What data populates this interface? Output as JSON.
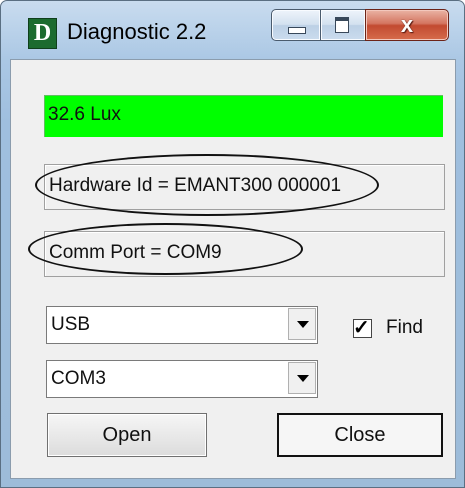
{
  "window": {
    "icon_letter": "D",
    "title": "Diagnostic 2.2",
    "close_glyph": "x"
  },
  "readings": {
    "lux": "32.6 Lux",
    "hardware_id": "Hardware Id = EMANT300 000001",
    "comm_port": "Comm Port = COM9"
  },
  "controls": {
    "interface_select": "USB",
    "port_select": "COM3",
    "find_label": "Find",
    "find_checked": true,
    "open_label": "Open",
    "close_label": "Close"
  },
  "colors": {
    "lux_background": "#00ff00",
    "icon_background": "#1c6b2f"
  }
}
